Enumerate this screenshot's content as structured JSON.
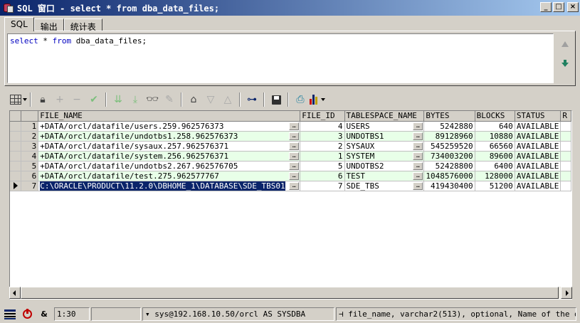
{
  "window": {
    "title": "SQL 窗口 - select * from dba_data_files;"
  },
  "tabs": [
    {
      "label": "SQL",
      "active": true
    },
    {
      "label": "输出",
      "active": false
    },
    {
      "label": "统计表",
      "active": false
    }
  ],
  "editor": {
    "kw_select": "select",
    "star": " * ",
    "kw_from": "from",
    "rest": " dba_data_files;"
  },
  "grid": {
    "columns": [
      "FILE_NAME",
      "FILE_ID",
      "TABLESPACE_NAME",
      "BYTES",
      "BLOCKS",
      "STATUS",
      "R"
    ],
    "ellipsis": "…",
    "rows": [
      {
        "n": "1",
        "file_name": "+DATA/orcl/datafile/users.259.962576373",
        "file_id": "4",
        "ts": "USERS",
        "bytes": "5242880",
        "blocks": "640",
        "status": "AVAILABLE"
      },
      {
        "n": "2",
        "file_name": "+DATA/orcl/datafile/undotbs1.258.962576373",
        "file_id": "3",
        "ts": "UNDOTBS1",
        "bytes": "89128960",
        "blocks": "10880",
        "status": "AVAILABLE"
      },
      {
        "n": "3",
        "file_name": "+DATA/orcl/datafile/sysaux.257.962576371",
        "file_id": "2",
        "ts": "SYSAUX",
        "bytes": "545259520",
        "blocks": "66560",
        "status": "AVAILABLE"
      },
      {
        "n": "4",
        "file_name": "+DATA/orcl/datafile/system.256.962576371",
        "file_id": "1",
        "ts": "SYSTEM",
        "bytes": "734003200",
        "blocks": "89600",
        "status": "AVAILABLE"
      },
      {
        "n": "5",
        "file_name": "+DATA/orcl/datafile/undotbs2.267.962576705",
        "file_id": "5",
        "ts": "UNDOTBS2",
        "bytes": "52428800",
        "blocks": "6400",
        "status": "AVAILABLE"
      },
      {
        "n": "6",
        "file_name": "+DATA/orcl/datafile/test.275.962577767",
        "file_id": "6",
        "ts": "TEST",
        "bytes": "1048576000",
        "blocks": "128000",
        "status": "AVAILABLE"
      },
      {
        "n": "7",
        "file_name": "C:\\ORACLE\\PRODUCT\\11.2.0\\DBHOME_1\\DATABASE\\SDE_TBS01",
        "file_id": "7",
        "ts": "SDE_TBS",
        "bytes": "419430400",
        "blocks": "51200",
        "status": "AVAILABLE"
      }
    ]
  },
  "statusbar": {
    "amp": "&",
    "position": "1:30",
    "connection": "sys@192.168.10.50/orcl AS SYSDBA",
    "hint": "file_name, varchar2(513), optional, Name of the da"
  }
}
